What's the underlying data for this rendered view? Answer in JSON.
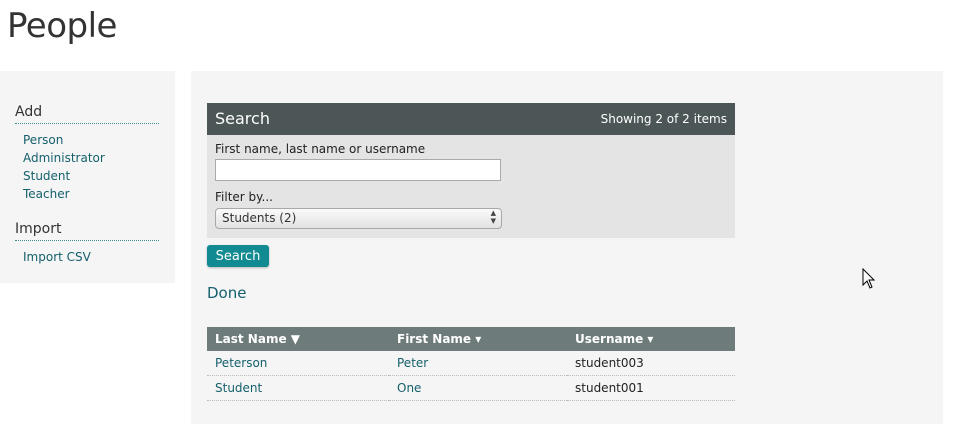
{
  "page": {
    "title": "People"
  },
  "sidebar": {
    "add_heading": "Add",
    "add_links": [
      "Person",
      "Administrator",
      "Student",
      "Teacher"
    ],
    "import_heading": "Import",
    "import_links": [
      "Import CSV"
    ]
  },
  "search": {
    "title": "Search",
    "count": "Showing 2 of 2 items",
    "name_label": "First name, last name or username",
    "name_value": "",
    "filter_label": "Filter by...",
    "filter_selected": "Students (2)",
    "button_label": "Search",
    "done_label": "Done"
  },
  "table": {
    "columns": [
      "Last Name ▼",
      "First Name ▾",
      "Username ▾"
    ],
    "rows": [
      [
        "Peterson",
        "Peter",
        "student003"
      ],
      [
        "Student",
        "One",
        "student001"
      ]
    ]
  },
  "colors": {
    "header_dark": "#4c5656",
    "table_header": "#6e7b7b",
    "accent": "#118a91",
    "link": "#14606c"
  },
  "icons": {
    "cursor": "mouse-pointer-icon"
  }
}
